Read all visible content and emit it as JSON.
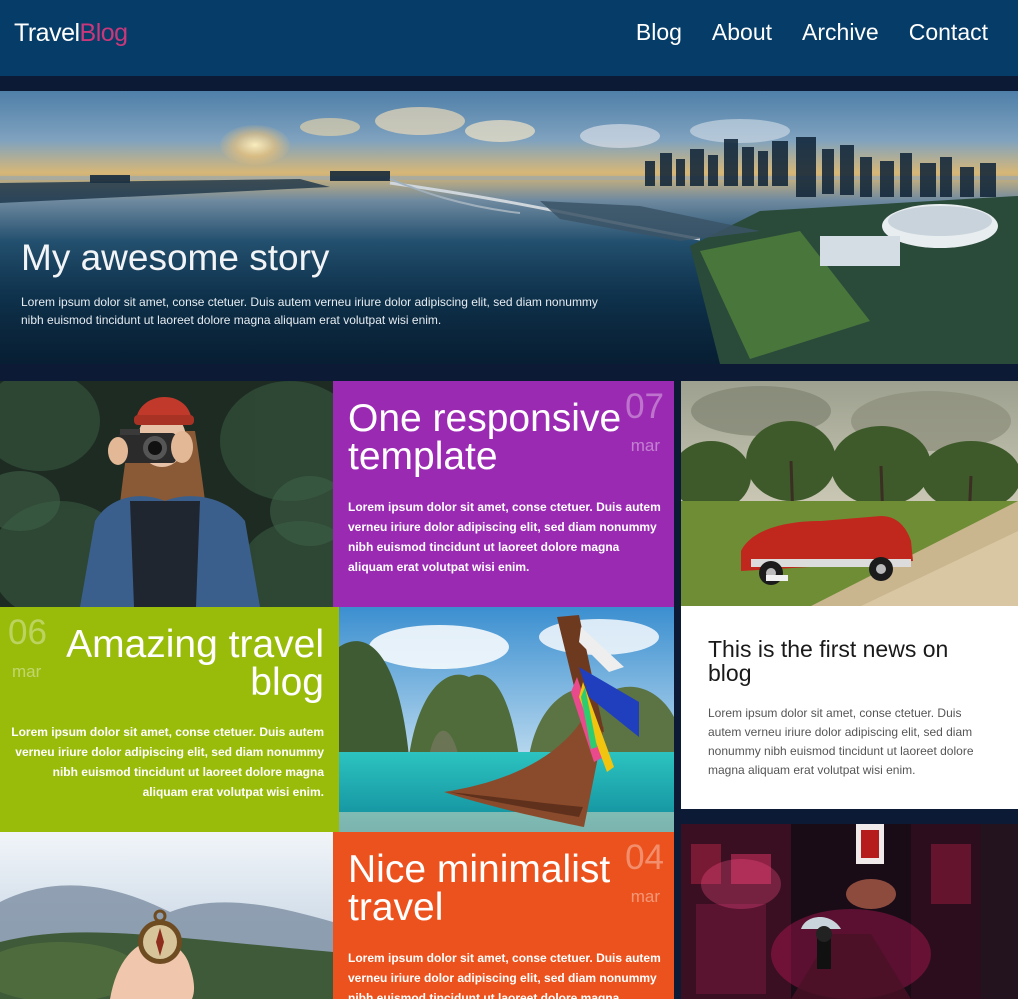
{
  "header": {
    "logo_primary": "Travel",
    "logo_accent": "Blog",
    "nav": [
      "Blog",
      "About",
      "Archive",
      "Contact"
    ]
  },
  "hero": {
    "title": "My awesome story",
    "text": "Lorem ipsum dolor sit amet, conse ctetuer. Duis autem verneu iriure dolor adipiscing elit, sed diam nonummy nibh euismod tincidunt ut laoreet dolore magna aliquam erat volutpat wisi enim."
  },
  "posts": [
    {
      "title": "One responsive template",
      "day": "07",
      "month": "mar",
      "text": "Lorem ipsum dolor sit amet, conse ctetuer. Duis autem verneu iriure dolor adipiscing elit, sed diam nonummy nibh euismod tincidunt ut laoreet dolore magna aliquam erat volutpat wisi enim.",
      "color": "#9b2ab3"
    },
    {
      "title": "Amazing travel blog",
      "day": "06",
      "month": "mar",
      "text": "Lorem ipsum dolor sit amet, conse ctetuer. Duis autem verneu iriure dolor adipiscing elit, sed diam nonummy nibh euismod tincidunt ut laoreet dolore magna aliquam erat volutpat wisi enim.",
      "color": "#99bc0b"
    },
    {
      "title": "Nice minimalist travel",
      "day": "04",
      "month": "mar",
      "text": "Lorem ipsum dolor sit amet, conse ctetuer. Duis autem verneu iriure dolor adipiscing elit, sed diam nonummy nibh euismod tincidunt ut laoreet dolore magna aliquam erat",
      "color": "#ec521d"
    }
  ],
  "news": {
    "title": "This is the first news on blog",
    "text": "Lorem ipsum dolor sit amet, conse ctetuer. Duis autem verneu iriure dolor adipiscing elit, sed diam nonummy nibh euismod tincidunt ut laoreet dolore magna aliquam erat volutpat wisi enim."
  },
  "colors": {
    "header_bg": "#063c68",
    "logo_accent": "#c8387a",
    "page_bg": "#0c1a36"
  }
}
